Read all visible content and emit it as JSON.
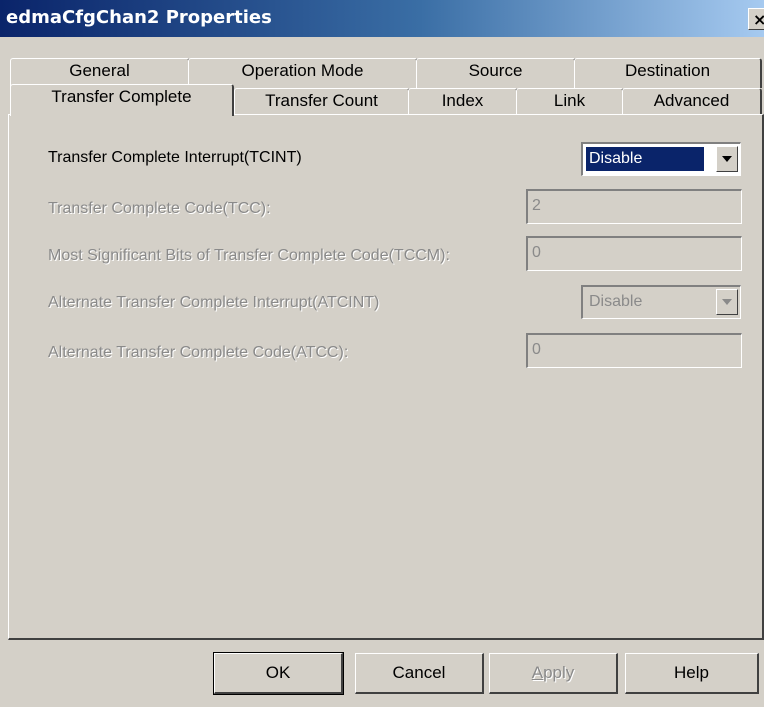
{
  "window": {
    "title": "edmaCfgChan2 Properties",
    "close_glyph": "×"
  },
  "tabs": {
    "back_row": [
      {
        "label": "General"
      },
      {
        "label": "Operation Mode"
      },
      {
        "label": "Source"
      },
      {
        "label": "Destination"
      }
    ],
    "front_row": [
      {
        "label": "Transfer Complete",
        "active": true
      },
      {
        "label": "Transfer Count"
      },
      {
        "label": "Index"
      },
      {
        "label": "Link"
      },
      {
        "label": "Advanced"
      }
    ]
  },
  "form": {
    "tcint": {
      "label": "Transfer Complete Interrupt(TCINT)",
      "value": "Disable",
      "enabled": true
    },
    "tcc": {
      "label": "Transfer Complete Code(TCC):",
      "value": "2",
      "enabled": false
    },
    "tccm": {
      "label": "Most Significant Bits of Transfer Complete Code(TCCM):",
      "value": "0",
      "enabled": false
    },
    "atcint": {
      "label": "Alternate Transfer Complete Interrupt(ATCINT)",
      "value": "Disable",
      "enabled": false
    },
    "atcc": {
      "label": "Alternate Transfer Complete Code(ATCC):",
      "value": "0",
      "enabled": false
    }
  },
  "buttons": {
    "ok": "OK",
    "cancel": "Cancel",
    "apply": "Apply",
    "apply_accel": "A",
    "apply_rest": "pply",
    "help": "Help"
  }
}
